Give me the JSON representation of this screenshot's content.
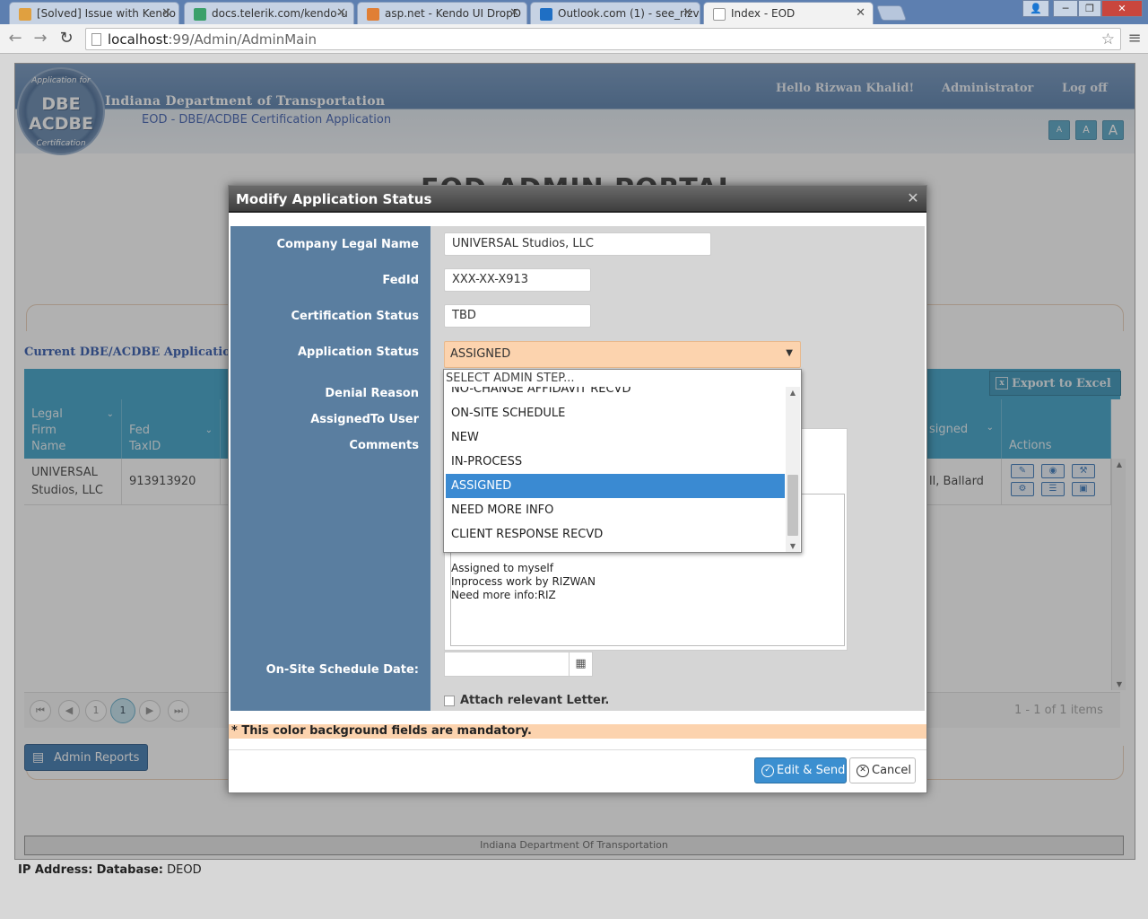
{
  "browser": {
    "tabs": [
      {
        "title": "[Solved] Issue with Kendo",
        "active": false
      },
      {
        "title": "docs.telerik.com/kendo-u",
        "active": false
      },
      {
        "title": "asp.net - Kendo UI DropD",
        "active": false
      },
      {
        "title": "Outlook.com (1) - see_rizv",
        "active": false
      },
      {
        "title": "Index - EOD",
        "active": true
      }
    ],
    "url_host": "localhost",
    "url_rest": ":99/Admin/AdminMain",
    "window_minimize": "─",
    "window_maximize": "❐",
    "window_close": "✕",
    "user_icon": "👤"
  },
  "header": {
    "logo_line1": "DBE",
    "logo_line2": "ACDBE",
    "logo_arc_top": "Application for",
    "logo_arc_bottom": "Certification",
    "org_name": "Indiana Department of Transportation",
    "app_name": "EOD - DBE/ACDBE Certification Application",
    "greeting": "Hello Rizwan Khalid!",
    "role_link": "Administrator",
    "logoff_link": "Log off",
    "font_small": "A",
    "font_medium": "A",
    "font_large": "A"
  },
  "portal": {
    "title": "EOD ADMIN PORTAL",
    "section_title": "Current DBE/ACDBE Applicatio",
    "export_label": "Export to Excel",
    "admin_reports_label": "Admin Reports"
  },
  "grid": {
    "columns": [
      {
        "label": "Legal Firm Name"
      },
      {
        "label": "Fed TaxID"
      },
      {
        "label": "signed"
      },
      {
        "label": "Actions"
      }
    ],
    "rows": [
      {
        "legal_name": "UNIVERSAL Studios, LLC",
        "fed_taxid": "913913920",
        "assigned": "ll, Ballard"
      }
    ],
    "pager": {
      "current_page_plain": "1",
      "current_page_active": "1",
      "info": "1 - 1 of 1 items"
    }
  },
  "footer": {
    "text": "Indiana Department Of Transportation",
    "ip_label": "IP Address:",
    "db_label": "Database:",
    "db_value": "DEOD"
  },
  "modal": {
    "title": "Modify Application Status",
    "labels": {
      "company_legal_name": "Company Legal Name",
      "fedid": "FedId",
      "certification_status": "Certification Status",
      "application_status": "Application Status",
      "denial_reason": "Denial Reason",
      "assigned_to_user": "AssignedTo User",
      "comments": "Comments",
      "onsite_date": "On-Site Schedule Date:"
    },
    "values": {
      "company_legal_name": "UNIVERSAL Studios, LLC",
      "fedid": "XXX-XX-X913",
      "certification_status": "TBD",
      "application_status": "ASSIGNED"
    },
    "comments_lines": "Assigned to myself\nInprocess work by RIZWAN\nNeed more info:RIZ",
    "attach_label": "Attach relevant Letter.",
    "mandatory_note": "* This color background fields are mandatory.",
    "edit_send_label": "Edit & Send",
    "cancel_label": "Cancel"
  },
  "dropdown": {
    "option_label": "SELECT ADMIN STEP...",
    "partial_top_item": "NO-CHANGE AFFIDAVIT RECVD",
    "items": [
      {
        "label": "ON-SITE SCHEDULE",
        "selected": false
      },
      {
        "label": "NEW",
        "selected": false
      },
      {
        "label": "IN-PROCESS",
        "selected": false
      },
      {
        "label": "ASSIGNED",
        "selected": true
      },
      {
        "label": "NEED MORE INFO",
        "selected": false
      },
      {
        "label": "CLIENT RESPONSE RECVD",
        "selected": false
      }
    ]
  },
  "colors": {
    "header_blue": "#4d76a6",
    "grid_header": "#2f9bc4",
    "mandatory_orange": "#fcd3ae",
    "label_column": "#5a7ea0",
    "selected_item": "#3a8ad2"
  }
}
